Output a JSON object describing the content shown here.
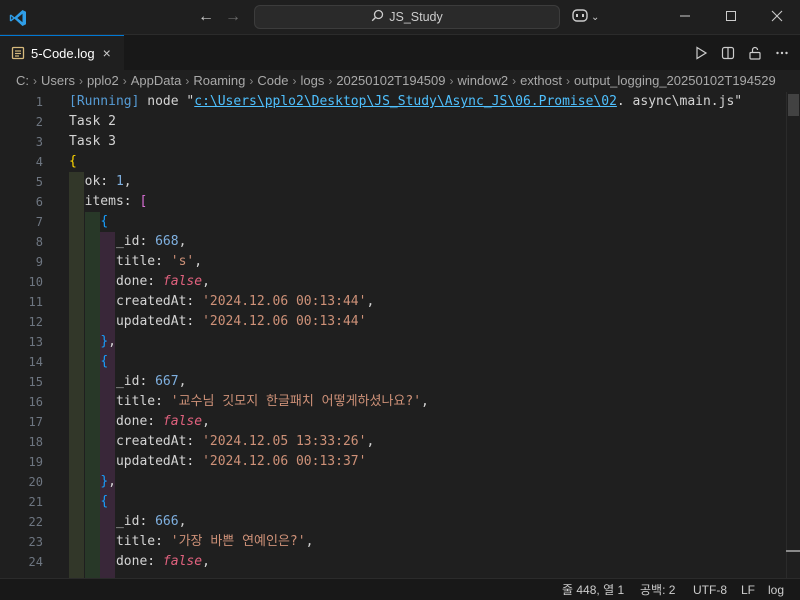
{
  "titlebar": {
    "search_label": "JS_Study",
    "icons": [
      "vscode-logo",
      "arrow-left-icon",
      "arrow-right-icon",
      "search-icon",
      "copilot-icon",
      "chevron-down-icon",
      "minimize-icon",
      "maximize-icon",
      "close-icon"
    ]
  },
  "tab": {
    "label": "5-Code.log",
    "close": "×"
  },
  "tab_actions": [
    "run-icon",
    "split-editor-icon",
    "lock-icon",
    "more-icon"
  ],
  "breadcrumb": [
    "C:",
    "Users",
    "pplo2",
    "AppData",
    "Roaming",
    "Code",
    "logs",
    "20250102T194509",
    "window2",
    "exthost",
    "output_logging_20250102T194529"
  ],
  "editor": {
    "lines": [
      {
        "n": "1",
        "parts": [
          [
            "dim",
            "[Running]"
          ],
          [
            "key",
            " node \""
          ],
          [
            "link",
            "c:\\Users\\pplo2\\Desktop\\JS_Study\\Async_JS\\06.Promise\\02"
          ],
          [
            "key",
            ". async\\main.js\""
          ]
        ]
      },
      {
        "n": "2",
        "parts": [
          [
            "key",
            "Task 2"
          ]
        ]
      },
      {
        "n": "3",
        "parts": [
          [
            "key",
            "Task 3"
          ]
        ]
      },
      {
        "n": "4",
        "parts": [
          [
            "brace",
            "{"
          ]
        ]
      },
      {
        "n": "5",
        "parts": [
          [
            "key",
            "  ok: "
          ],
          [
            "num",
            "1"
          ],
          [
            "key",
            ","
          ]
        ]
      },
      {
        "n": "6",
        "parts": [
          [
            "key",
            "  items: "
          ],
          [
            "bracket",
            "["
          ]
        ]
      },
      {
        "n": "7",
        "parts": [
          [
            "key",
            "    "
          ],
          [
            "brace2",
            "{"
          ]
        ]
      },
      {
        "n": "8",
        "parts": [
          [
            "key",
            "      _id: "
          ],
          [
            "num",
            "668"
          ],
          [
            "key",
            ","
          ]
        ]
      },
      {
        "n": "9",
        "parts": [
          [
            "key",
            "      title: "
          ],
          [
            "str",
            "'s'"
          ],
          [
            "key",
            ","
          ]
        ]
      },
      {
        "n": "10",
        "parts": [
          [
            "key",
            "      done: "
          ],
          [
            "bool",
            "false"
          ],
          [
            "key",
            ","
          ]
        ]
      },
      {
        "n": "11",
        "parts": [
          [
            "key",
            "      createdAt: "
          ],
          [
            "str",
            "'2024.12.06 00:13:44'"
          ],
          [
            "key",
            ","
          ]
        ]
      },
      {
        "n": "12",
        "parts": [
          [
            "key",
            "      updatedAt: "
          ],
          [
            "str",
            "'2024.12.06 00:13:44'"
          ]
        ]
      },
      {
        "n": "13",
        "parts": [
          [
            "key",
            "    "
          ],
          [
            "brace2",
            "}"
          ],
          [
            "key",
            ","
          ]
        ]
      },
      {
        "n": "14",
        "parts": [
          [
            "key",
            "    "
          ],
          [
            "brace2",
            "{"
          ]
        ]
      },
      {
        "n": "15",
        "parts": [
          [
            "key",
            "      _id: "
          ],
          [
            "num",
            "667"
          ],
          [
            "key",
            ","
          ]
        ]
      },
      {
        "n": "16",
        "parts": [
          [
            "key",
            "      title: "
          ],
          [
            "str",
            "'교수님 깃모지 한글패치 어떻게하셨나요?'"
          ],
          [
            "key",
            ","
          ]
        ]
      },
      {
        "n": "17",
        "parts": [
          [
            "key",
            "      done: "
          ],
          [
            "bool",
            "false"
          ],
          [
            "key",
            ","
          ]
        ]
      },
      {
        "n": "18",
        "parts": [
          [
            "key",
            "      createdAt: "
          ],
          [
            "str",
            "'2024.12.05 13:33:26'"
          ],
          [
            "key",
            ","
          ]
        ]
      },
      {
        "n": "19",
        "parts": [
          [
            "key",
            "      updatedAt: "
          ],
          [
            "str",
            "'2024.12.06 00:13:37'"
          ]
        ]
      },
      {
        "n": "20",
        "parts": [
          [
            "key",
            "    "
          ],
          [
            "brace2",
            "}"
          ],
          [
            "key",
            ","
          ]
        ]
      },
      {
        "n": "21",
        "parts": [
          [
            "key",
            "    "
          ],
          [
            "brace2",
            "{"
          ]
        ]
      },
      {
        "n": "22",
        "parts": [
          [
            "key",
            "      _id: "
          ],
          [
            "num",
            "666"
          ],
          [
            "key",
            ","
          ]
        ]
      },
      {
        "n": "23",
        "parts": [
          [
            "key",
            "      title: "
          ],
          [
            "str",
            "'가장 바쁜 연예인은?'"
          ],
          [
            "key",
            ","
          ]
        ]
      },
      {
        "n": "24",
        "parts": [
          [
            "key",
            "      done: "
          ],
          [
            "bool",
            "false"
          ],
          [
            "key",
            ","
          ]
        ]
      }
    ]
  },
  "status": {
    "position": "줄 448, 열 1",
    "spaces": "공백: 2",
    "encoding": "UTF-8",
    "eol": "LF",
    "language": "log"
  },
  "colors": {
    "accent": "#0078d4",
    "background": "#1f1f1f"
  }
}
